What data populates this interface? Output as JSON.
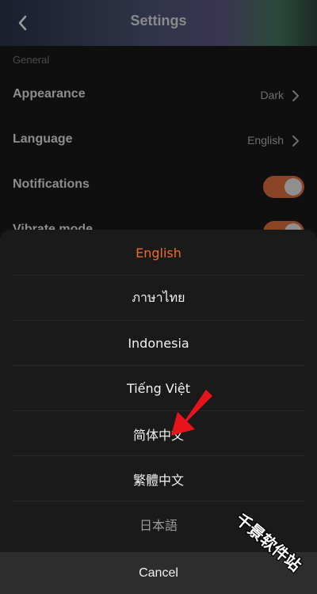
{
  "header": {
    "title": "Settings",
    "back_icon": "chevron-left-icon"
  },
  "settings": {
    "section": "General",
    "rows": [
      {
        "label": "Appearance",
        "value": "Dark"
      },
      {
        "label": "Language",
        "value": "English"
      },
      {
        "label": "Notifications",
        "toggle": true
      },
      {
        "label": "Vibrate mode",
        "toggle": true
      }
    ]
  },
  "language_sheet": {
    "options": [
      {
        "label": "English",
        "selected": true
      },
      {
        "label": "ภาษาไทย",
        "selected": false
      },
      {
        "label": "Indonesia",
        "selected": false
      },
      {
        "label": "Tiếng Việt",
        "selected": false
      },
      {
        "label": "简体中文",
        "selected": false
      },
      {
        "label": "繁體中文",
        "selected": false
      },
      {
        "label": "日本語",
        "selected": false
      }
    ],
    "cancel_label": "Cancel"
  },
  "overlay": {
    "watermark": "千景软件站"
  },
  "colors": {
    "accent": "#f06a28",
    "toggle_on": "#8a4426",
    "arrow": "#e8141b"
  }
}
